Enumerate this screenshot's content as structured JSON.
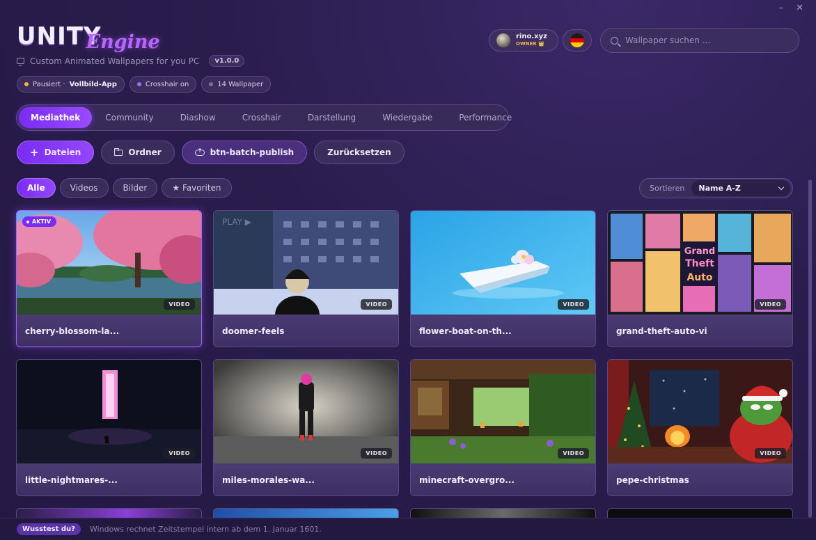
{
  "window": {
    "minimize": "–",
    "close": "✕"
  },
  "logo": {
    "primary": "UNITY",
    "secondary": "Engine"
  },
  "tagline": {
    "text": "Custom Animated Wallpapers for you PC",
    "version": "v1.0.0"
  },
  "status": [
    {
      "label": "Pausiert ·",
      "strong": "Vollbild-App",
      "dot_color": "#f2b63d"
    },
    {
      "label": "Crosshair on",
      "strong": "",
      "dot_color": "#a56cff"
    },
    {
      "label": "14 Wallpaper",
      "strong": "",
      "dot_color": "#7a6f95"
    }
  ],
  "user": {
    "name": "rino.xyz",
    "role": "OWNER 👑"
  },
  "search": {
    "placeholder": "Wallpaper suchen ..."
  },
  "tabs": [
    "Mediathek",
    "Community",
    "Diashow",
    "Crosshair",
    "Darstellung",
    "Wiedergabe",
    "Performance"
  ],
  "actions": {
    "files": "Dateien",
    "folder": "Ordner",
    "publish": "btn-batch-publish",
    "reset": "Zurücksetzen"
  },
  "filters": [
    "Alle",
    "Videos",
    "Bilder",
    "★ Favoriten"
  ],
  "sort": {
    "label": "Sortieren",
    "value": "Name A-Z"
  },
  "active_badge": "AKTIV",
  "video_badge": "VIDEO",
  "wallpapers": [
    {
      "title": "cherry-blossom-la...",
      "active": true
    },
    {
      "title": "doomer-feels"
    },
    {
      "title": "flower-boat-on-th..."
    },
    {
      "title": "grand-theft-auto-vi"
    },
    {
      "title": "little-nightmares-..."
    },
    {
      "title": "miles-morales-wa..."
    },
    {
      "title": "minecraft-overgro..."
    },
    {
      "title": "pepe-christmas"
    }
  ],
  "footer": {
    "badge": "Wusstest du?",
    "tip": "Windows rechnet Zeitstempel intern ab dem 1. Januar 1601."
  },
  "colors": {
    "accent": "#8a3cff",
    "background": "#2a1d4d"
  }
}
